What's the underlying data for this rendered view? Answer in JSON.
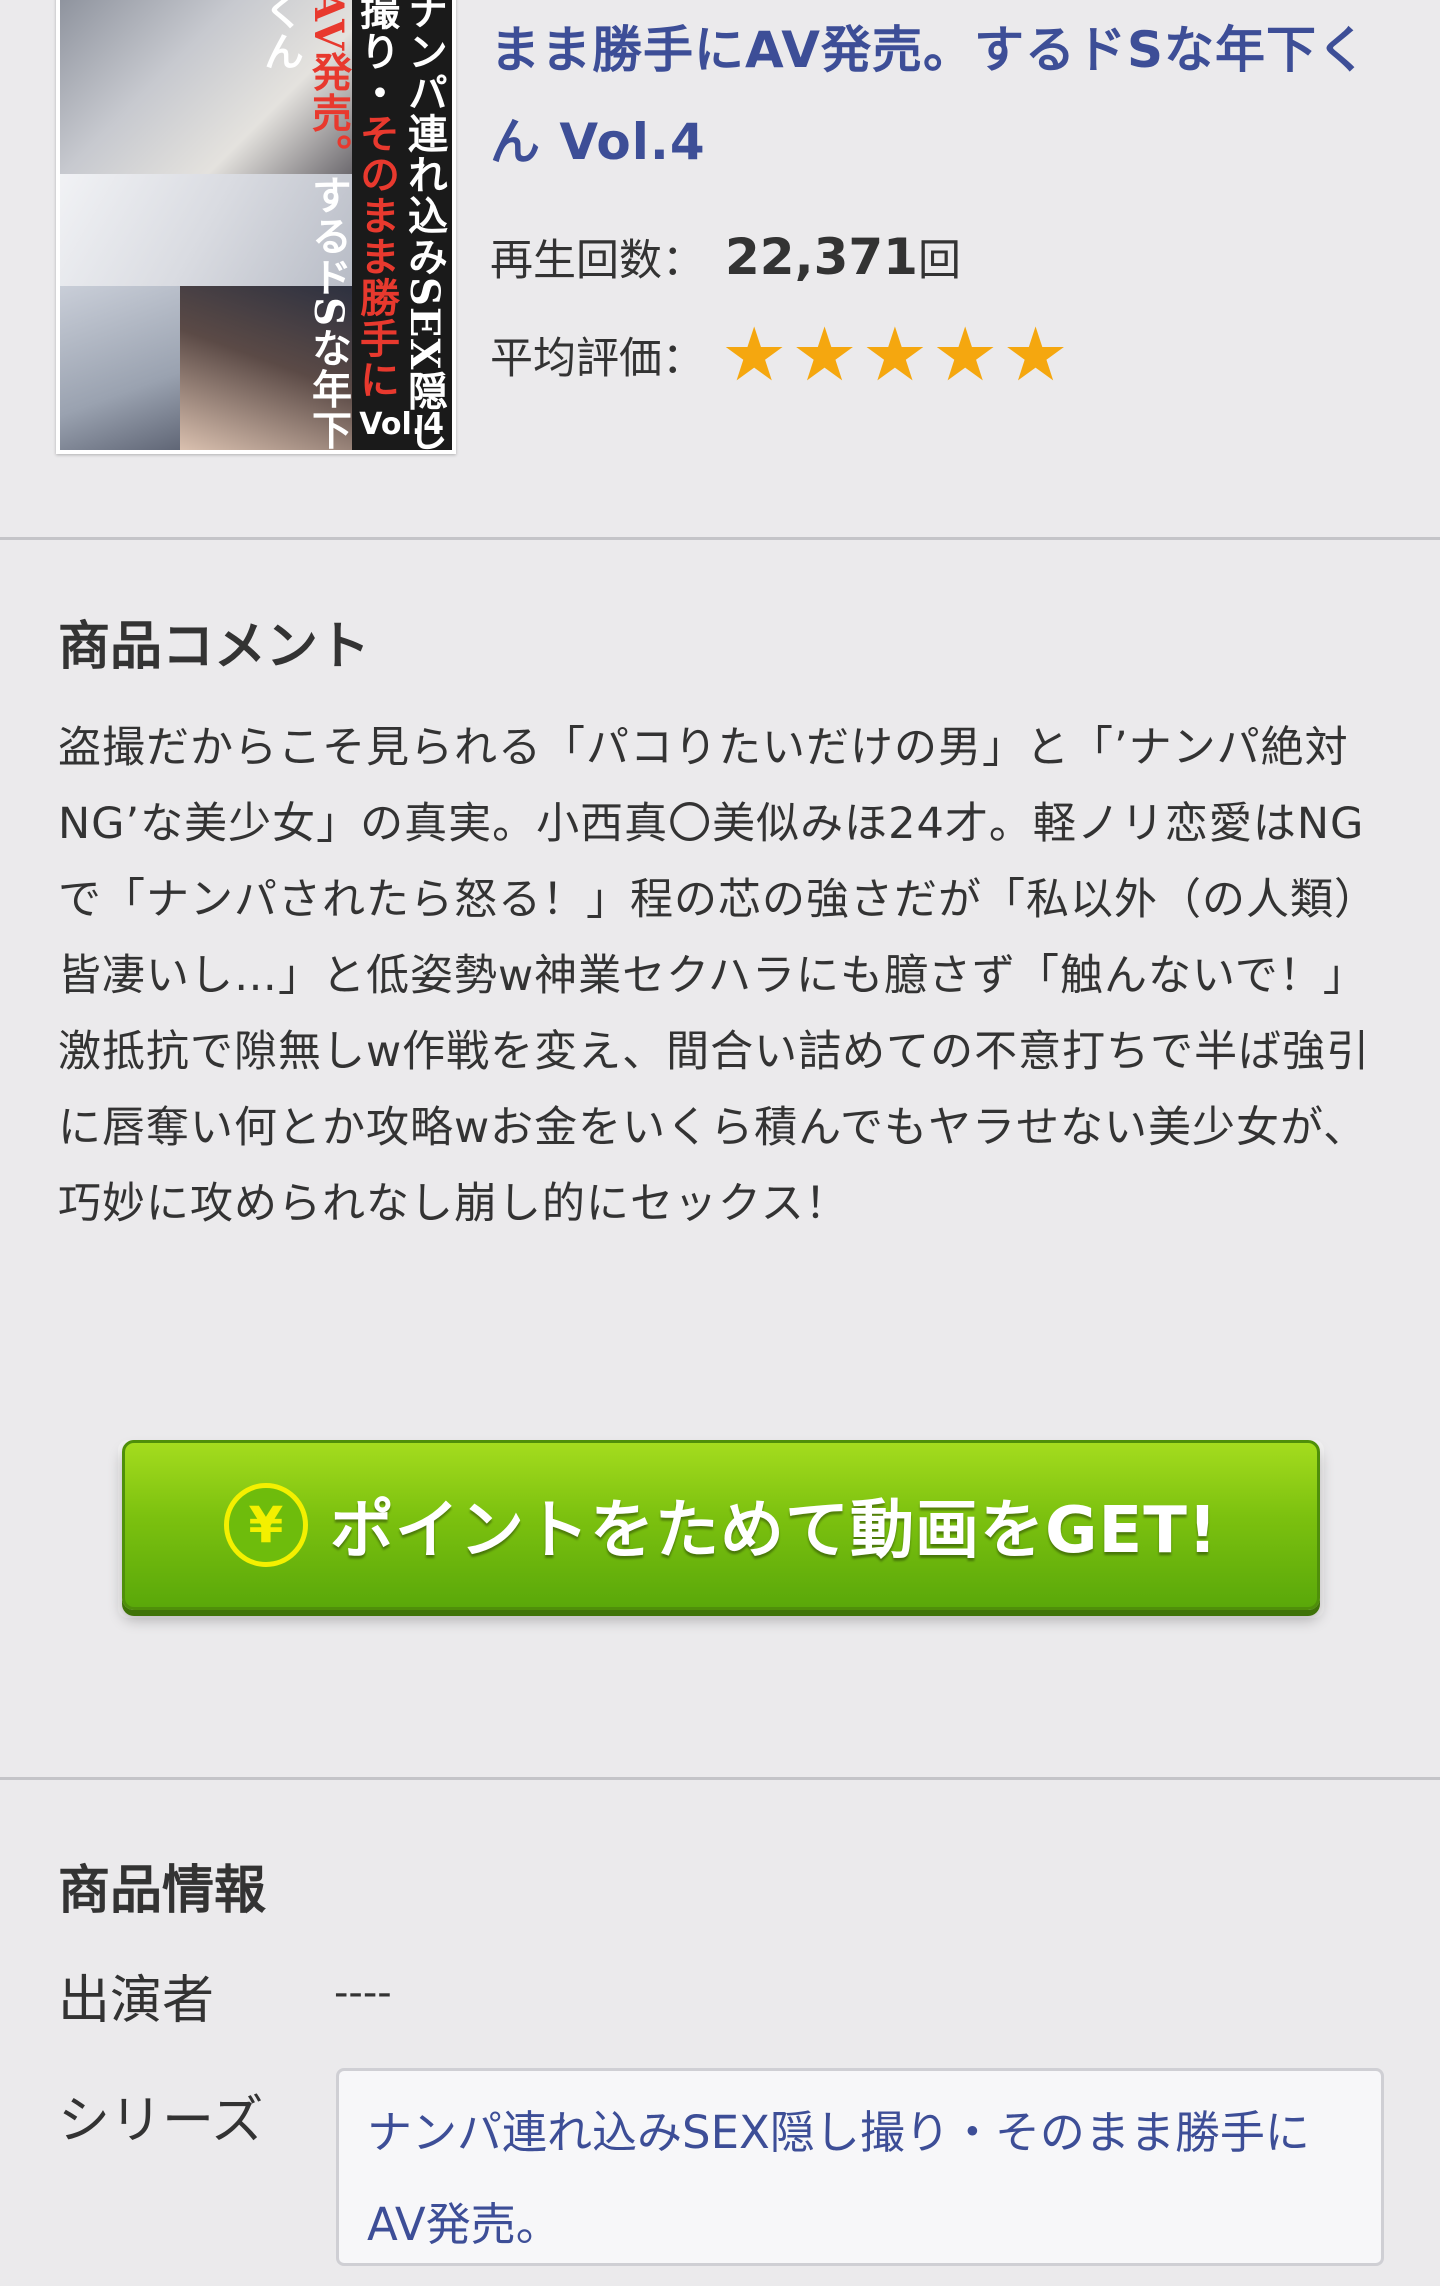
{
  "product": {
    "thumbnail_text": [
      "ナンパ連れ込みSEX隠し撮り・",
      "そのまま勝手にAV発売。",
      "するドSな年下くん"
    ],
    "thumbnail_vol": "Vol.4",
    "title": "まま勝手にAV発売。するドSな年下くん Vol.4",
    "views_label": "再生回数：",
    "views_value": "22,371",
    "views_unit": "回",
    "rating_label": "平均評価：",
    "rating_stars": 5,
    "star_color": "#f5a70f"
  },
  "comment": {
    "heading": "商品コメント",
    "body": "盗撮だからこそ見られる「パコりたいだけの男」と「’ナンパ絶対NG’な美少女」の真実。小西真〇美似みほ24才。軽ノリ恋愛はNGで「ナンパされたら怒る！」程の芯の強さだが「私以外（の人類）皆凄いし…」と低姿勢w神業セクハラにも臆さず「触んないで！」激抵抗で隙無しw作戦を変え、間合い詰めての不意打ちで半ば強引に唇奪い何とか攻略wお金をいくら積んでもヤラせない美少女が、巧妙に攻められなし崩し的にセックス！"
  },
  "cta": {
    "icon": "yen-icon",
    "icon_glyph": "¥",
    "label": "ポイントをためて動画をGET!",
    "color": "#7cc10f"
  },
  "info": {
    "heading": "商品情報",
    "cast_label": "出演者",
    "cast_value": "----",
    "series_label": "シリーズ",
    "series_value": "ナンパ連れ込みSEX隠し撮り・そのまま勝手にAV発売。"
  }
}
